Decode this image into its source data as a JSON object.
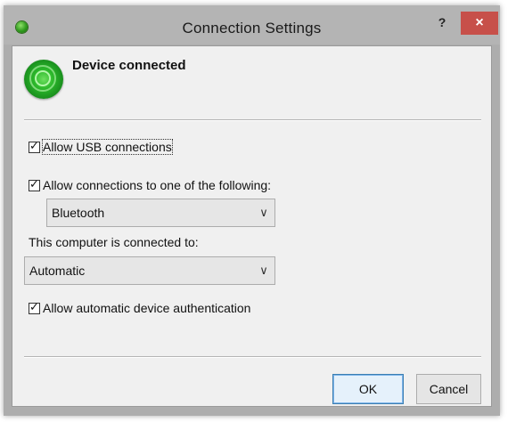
{
  "window": {
    "title": "Connection Settings",
    "help_label": "?",
    "close_label": "×"
  },
  "status": {
    "text": "Device connected",
    "icon": "device-connected-icon"
  },
  "options": {
    "allow_usb": {
      "label": "Allow USB connections",
      "checked": true
    },
    "allow_following": {
      "label": "Allow connections to one of the following:",
      "checked": true
    },
    "protocol_select": {
      "value": "Bluetooth"
    },
    "connected_to_label": "This computer is connected to:",
    "connection_select": {
      "value": "Automatic"
    },
    "auto_auth": {
      "label": "Allow automatic device authentication",
      "checked": true
    }
  },
  "buttons": {
    "ok": "OK",
    "cancel": "Cancel"
  },
  "colors": {
    "close_button": "#c7504a",
    "accent_border": "#3c7fb1"
  }
}
